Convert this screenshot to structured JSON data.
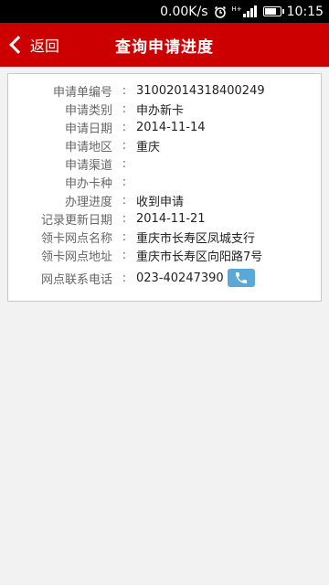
{
  "status_bar": {
    "speed": "0.00K/s",
    "network": "H+",
    "time": "10:15"
  },
  "nav": {
    "back_label": "返回",
    "title": "查询申请进度"
  },
  "details": {
    "rows": [
      {
        "label": "申请单编号",
        "value": "31002014318400249"
      },
      {
        "label": "申请类别",
        "value": "申办新卡"
      },
      {
        "label": "申请日期",
        "value": "2014-11-14"
      },
      {
        "label": "申请地区",
        "value": "重庆"
      },
      {
        "label": "申请渠道",
        "value": ""
      },
      {
        "label": "申办卡种",
        "value": ""
      },
      {
        "label": "办理进度",
        "value": "收到申请"
      },
      {
        "label": "记录更新日期",
        "value": "2014-11-21"
      },
      {
        "label": "领卡网点名称",
        "value": "重庆市长寿区凤城支行"
      },
      {
        "label": "领卡网点地址",
        "value": "重庆市长寿区向阳路7号"
      },
      {
        "label": "网点联系电话",
        "value": "023-40247390"
      }
    ],
    "colon": ":"
  },
  "icons": {
    "alarm": "alarm-icon",
    "signal": "signal-icon",
    "battery": "battery-icon",
    "back": "chevron-left-icon",
    "phone": "phone-icon"
  },
  "colors": {
    "nav_bg": "#cc0000",
    "phone_btn": "#5aa8d8"
  }
}
